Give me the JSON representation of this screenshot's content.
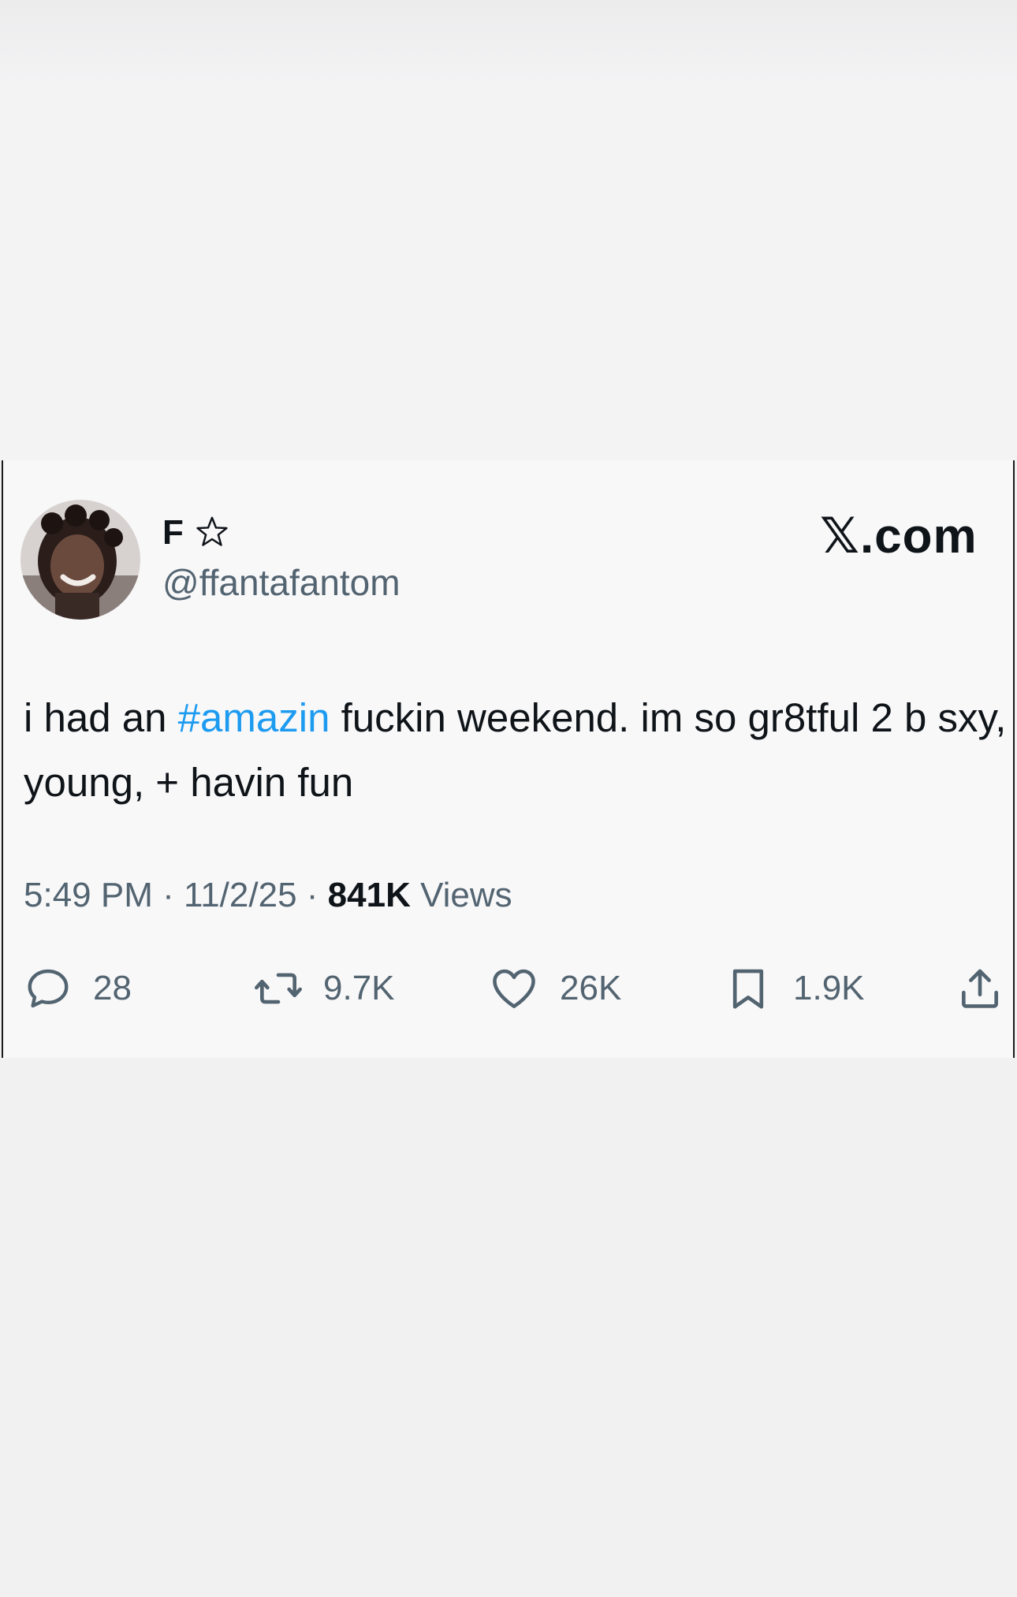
{
  "site_brand": "𝕏.com",
  "author": {
    "display_name": "F",
    "handle": "@ffantafantom"
  },
  "tweet": {
    "text_before": "i had an ",
    "hashtag": "#amazin",
    "text_after": " fuckin weekend. im so gr8tful 2 b sxy, young, + havin fun"
  },
  "meta": {
    "time": "5:49 PM",
    "separator": "·",
    "date": "11/2/25",
    "views_count": "841K",
    "views_label": "Views"
  },
  "actions": {
    "replies": "28",
    "reposts": "9.7K",
    "likes": "26K",
    "bookmarks": "1.9K"
  },
  "colors": {
    "hashtag": "#1d9bf0",
    "secondary_text": "#536471",
    "primary_text": "#0f1419"
  },
  "icons": [
    "star-icon",
    "reply-icon",
    "repost-icon",
    "like-icon",
    "bookmark-icon",
    "share-icon"
  ]
}
